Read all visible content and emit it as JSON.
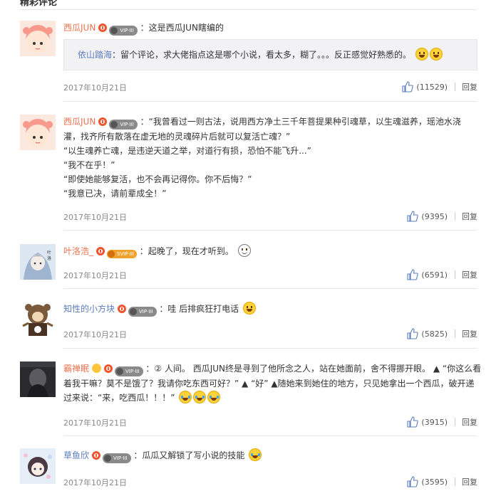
{
  "section_title": "精彩评论",
  "colors": {
    "username": "#eb7350",
    "link": "#5a7cbc",
    "date": "#888888",
    "badge_red": "#f0542f",
    "svip": "#f1a22e"
  },
  "comments": [
    {
      "username": "西瓜JUN",
      "badges": [
        "red-badge",
        "vip-badge"
      ],
      "vip_label": "VIP·III",
      "lines": [
        "：这是西瓜JUN瞎编的"
      ],
      "reply": {
        "username": "依山踏海",
        "text": "：留个评论，求大佬指点这是哪个小说，看太多，糊了。。。反正感觉好熟悉的。",
        "emoji": [
          "grin-emoji",
          "grin-emoji"
        ]
      },
      "date": "2017年10月21日",
      "likes": "(11529)",
      "reply_label": "回复"
    },
    {
      "username": "西瓜JUN",
      "badges": [
        "red-badge",
        "vip-badge"
      ],
      "vip_label": "VIP·III",
      "lines": [
        "：“我曾看过一则古法，说用西方净土三千年菩提果种引魂草，以生魂滋养，瑶池水浇",
        "灌，找齐所有散落在虚无地的灵魂碎片后就可以复活亡魂？”",
        "“以生魂养亡魂，是违逆天道之举，对道行有损，恐怕不能飞升...”",
        "“我不在乎！”",
        "“即使她能够复活，也不会再记得你。你不后悔？”",
        "“我意已决，请前辈成全！”"
      ],
      "date": "2017年10月21日",
      "likes": "(9395)",
      "reply_label": "回复"
    },
    {
      "username": "叶洛浩_",
      "badges": [
        "red-badge",
        "svip-badge"
      ],
      "vip_label": "SVIP·III",
      "lines": [
        "：起晚了，现在才听到。"
      ],
      "emoji": [
        "smile-emoji"
      ],
      "date": "2017年10月21日",
      "likes": "(6591)",
      "reply_label": "回复"
    },
    {
      "username": "知性的小方块",
      "badges": [
        "red-badge",
        "vip-badge"
      ],
      "vip_label": "VIP·III",
      "lines": [
        "：哇 后排疯狂打电话"
      ],
      "emoji": [
        "grin-emoji"
      ],
      "date": "2017年10月21日",
      "likes": "(5825)",
      "reply_label": "回复"
    },
    {
      "username": "霸禅眠",
      "badges": [
        "sun-badge",
        "red-badge",
        "vip-badge"
      ],
      "vip_label": "VIP·III",
      "lines": [
        "：② 人间。 西瓜JUN终是寻到了他所念之人，站在她面前，舍不得挪开眼。 ▲ “你这么看",
        "着我干嘛？莫不是饿了？我请你吃东西可好？” ▲ “好” ▲随她来到她住的地方，只见她拿出一个西瓜，破开递",
        "过来说：“来，吃西瓜！！！”"
      ],
      "emoji": [
        "laugh-cry-emoji",
        "laugh-cry-emoji",
        "laugh-cry-emoji"
      ],
      "date": "2017年10月21日",
      "likes": "(3915)",
      "reply_label": "回复"
    },
    {
      "username": "草鱼欣",
      "badges": [
        "red-badge",
        "vip-badge"
      ],
      "vip_label": "VIP·III",
      "lines": [
        "：瓜瓜又解锁了写小说的技能"
      ],
      "emoji": [
        "laugh-cry-emoji"
      ],
      "date": "2017年10月21日",
      "likes": "(3595)",
      "reply_label": "回复"
    }
  ]
}
